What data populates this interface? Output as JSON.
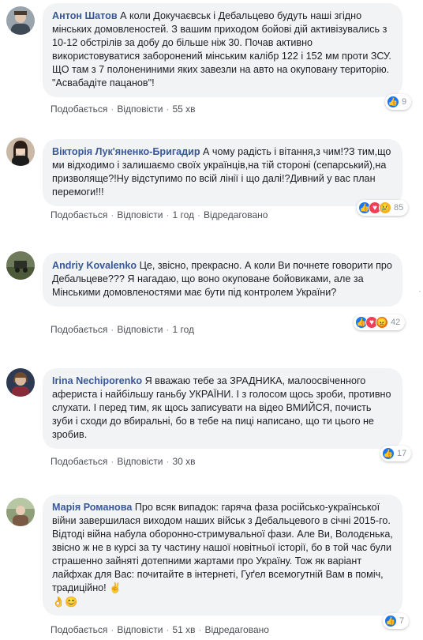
{
  "comments": [
    {
      "author": "Антон Шатов",
      "text": "А коли Докучаєвськ і Дебальцево будуть наші згідно мінських домовленостей. З вашим приходом бойові дій активізувались з 10-12 обстрілів за добу до більше ніж 30. Почав активно використовуватися заборонений мінським калібр 122 і 152 мм проти ЗСУ. ЩО там з 7 полонениними яких завезли на авто на окуповану територію. \"Асвабадіте пацанов\"!",
      "like": "Подобається",
      "reply": "Відповісти",
      "time": "55 хв",
      "reaction_count": "9"
    },
    {
      "author": "Вікторія Лук'яненко-Бригадир",
      "text": "А чому радість і вітання,з чим!?З тим,що ми відходимо і залишаємо своїх українців,на тій стороні (сепарський),на призволяще?!Ну відступимо по всій лінії і що далі!?Дивний у вас план перемоги!!!",
      "like": "Подобається",
      "reply": "Відповісти",
      "time": "1 год",
      "edited": "Відредаговано",
      "reaction_count": "85"
    },
    {
      "author": "Andriy Kovalenko",
      "text": "Це, звісно, прекрасно. А коли Ви почнете говорити про Дебальцеве??? Я нагадаю, що воно окуповане бойовиками, але за Мінськими домовленостями має бути під контролем України?",
      "like": "Подобається",
      "reply": "Відповісти",
      "time": "1 год",
      "reaction_count": "42"
    },
    {
      "author": "Irina Nechiporenko",
      "text": "Я вважаю тебе за ЗРАДНИКА, малоосвіченного афериста і найбільшу ганьбу УКРАЇНИ. І з голосом щось зроби, противно слухати. І перед тим, як щось записувати на відео ВМИЙСЯ, почисть зуби і сходи до вбиральні, бо в тебе на пиці написано, що ти цього не зробив.",
      "like": "Подобається",
      "reply": "Відповісти",
      "time": "30 хв",
      "reaction_count": "17"
    },
    {
      "author": "Марія Романова",
      "text": "Про всяк випадок: гаряча фаза російсько-української війни завершилася виходом наших військ з Дебальцевого в січні 2015-го. Відтоді війна набула оборонно-стримувальної фази. Але Ви, Володєнька, звісно ж не в курсі за ту частину нашої новітньої історії, бо в той час були страшенно зайняті дотепними жартами про Україну. Тож як варіант лайфхак для Вас: почитайте в інтернеті, Гуґел всемогутній Вам в поміч, традиційно! ✌️",
      "emoji_line": "👌😊",
      "like": "Подобається",
      "reply": "Відповісти",
      "time": "51 хв",
      "edited": "Відредаговано",
      "reaction_count": "7"
    }
  ],
  "icons": {
    "like": "thumbs-up-icon",
    "love": "heart-icon",
    "sad": "crying-face-icon",
    "angry": "angry-face-icon"
  },
  "colors": {
    "author": "#385898",
    "bubble": "#f2f3f5",
    "like": "#1877f2",
    "love": "#f33e58",
    "sad": "#f7b125",
    "angry": "#e9710f"
  }
}
